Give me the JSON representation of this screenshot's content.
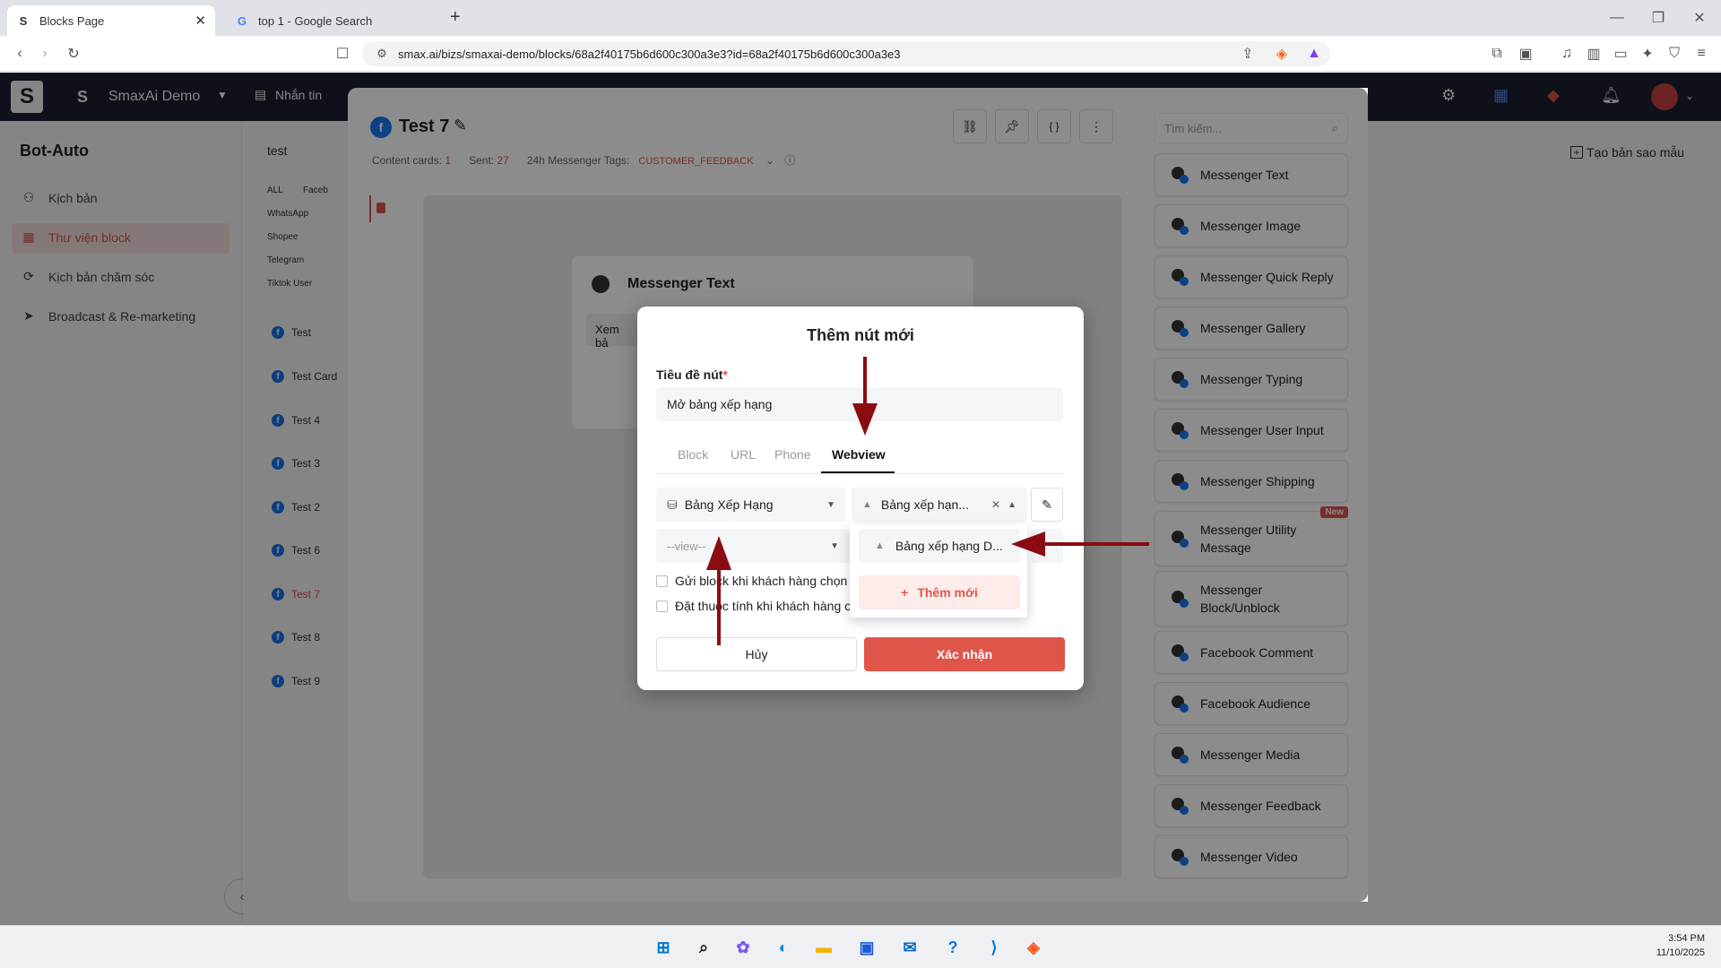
{
  "browser": {
    "tabs": [
      {
        "title": "Blocks Page",
        "favicon": "S"
      },
      {
        "title": "top 1 - Google Search",
        "favicon": "G"
      }
    ],
    "new_tab_label": "+",
    "url": "smax.ai/bizs/smaxai-demo/blocks/68a2f40175b6d600c300a3e3?id=68a2f40175b6d600c300a3e3"
  },
  "topnav": {
    "logo_letter": "S",
    "workspace_letter": "S",
    "workspace_name": "SmaxAi Demo",
    "nav_item": "Nhắn tin"
  },
  "sidebar": {
    "title": "Bot-Auto",
    "items": [
      {
        "label": "Kịch bản"
      },
      {
        "label": "Thư viện block"
      },
      {
        "label": "Kịch bản chăm sóc"
      },
      {
        "label": "Broadcast & Re-marketing"
      }
    ]
  },
  "list": {
    "search_value": "test",
    "channels": [
      "ALL",
      "Faceb",
      "WhatsApp",
      "Shopee",
      "Telegram",
      "Tiktok User"
    ],
    "blocks": [
      "Test",
      "Test Card",
      "Test 4",
      "Test 3",
      "Test 2",
      "Test 6",
      "Test 7",
      "Test 8",
      "Test 9"
    ]
  },
  "editor": {
    "title": "Test 7",
    "content_cards_label": "Content cards:",
    "content_cards_value": "1",
    "sent_label": "Sent:",
    "sent_value": "27",
    "tags_label": "24h Messenger Tags:",
    "tags_value": "CUSTOMER_FEEDBACK",
    "card_title": "Messenger Text",
    "card_text": "Xem bả",
    "copy_template": "Tạo bản sao mẫu"
  },
  "palette": {
    "search_placeholder": "Tìm kiếm...",
    "items": [
      {
        "label": "Messenger Text"
      },
      {
        "label": "Messenger Image"
      },
      {
        "label": "Messenger Quick Reply"
      },
      {
        "label": "Messenger Gallery"
      },
      {
        "label": "Messenger Typing"
      },
      {
        "label": "Messenger User Input"
      },
      {
        "label": "Messenger Shipping"
      },
      {
        "label": "Messenger Utility Message",
        "badge": "New"
      },
      {
        "label": "Messenger Block/Unblock"
      },
      {
        "label": "Facebook Comment"
      },
      {
        "label": "Facebook Audience"
      },
      {
        "label": "Messenger Media"
      },
      {
        "label": "Messenger Feedback"
      },
      {
        "label": "Messenger Video"
      }
    ]
  },
  "modal": {
    "title": "Thêm nút mới",
    "field_label": "Tiêu đề nút",
    "required_mark": "*",
    "field_value": "Mở bảng xếp hạng",
    "tabs": [
      "Block",
      "URL",
      "Phone",
      "Webview"
    ],
    "active_tab": "Webview",
    "select_app": "Bảng Xếp Hạng",
    "select_page": "Bảng xếp hạn...",
    "select_view_placeholder": "--view--",
    "dropdown_option": "Bảng xếp hạng D...",
    "dropdown_add": "Thêm mới",
    "checkbox_1": "Gửi block khi khách hàng chọn",
    "checkbox_2": "Đặt thuộc tính khi khách hàng c",
    "cancel": "Hủy",
    "confirm": "Xác nhận"
  },
  "taskbar": {
    "time": "3:54 PM",
    "date": "11/10/2025"
  },
  "colors": {
    "accent": "#e0554a",
    "nav_bg": "#1c2230",
    "arrow": "#8b0b12",
    "facebook": "#1877f2"
  }
}
